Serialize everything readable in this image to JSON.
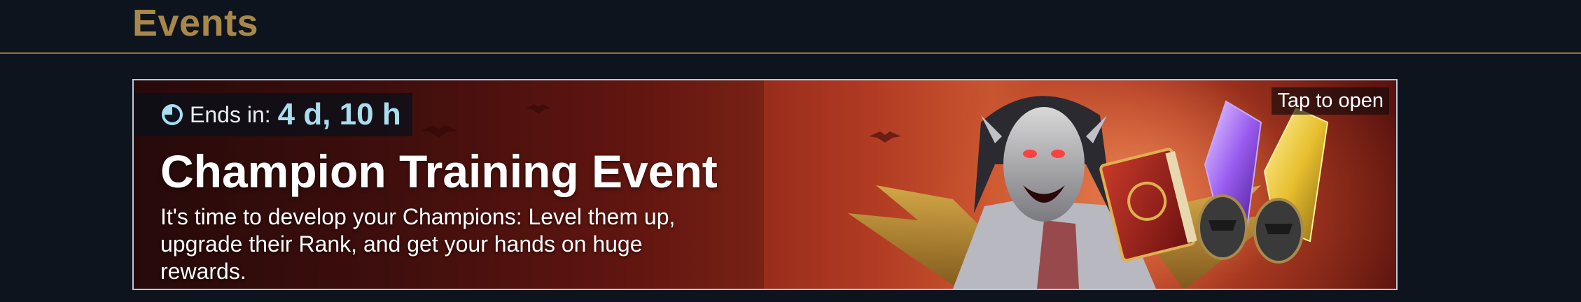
{
  "section": {
    "title": "Events"
  },
  "event": {
    "ends_label": "Ends in:",
    "ends_value": "4 d, 10 h",
    "title": "Champion Training Event",
    "description": "It's time to develop your Champions: Level them up, upgrade their Rank, and get your hands on huge rewards.",
    "tap_label": "Tap to open"
  },
  "colors": {
    "background": "#0e141d",
    "title_gold": "#a9874a",
    "divider": "#8a7440",
    "card_border": "#b9c9d9",
    "timer_accent": "#a9def0"
  },
  "icons": {
    "clock": "clock-icon"
  }
}
